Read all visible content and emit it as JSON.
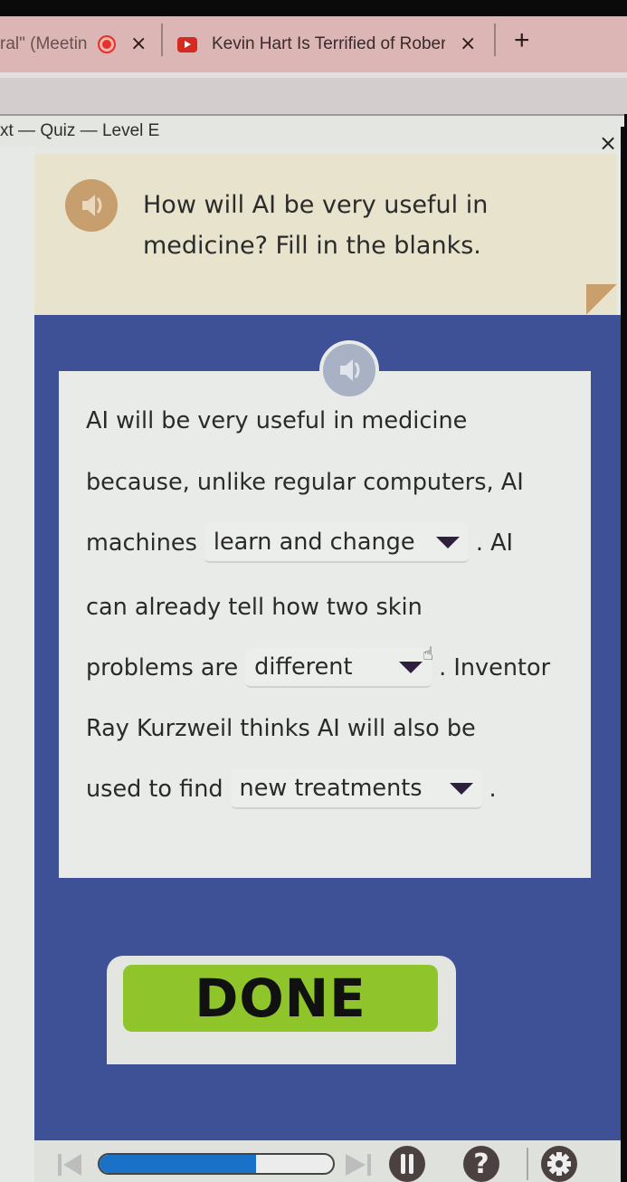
{
  "browser": {
    "tabs": [
      {
        "title": "ral\" (Meetin",
        "icon": "recording-icon",
        "close_label": "×"
      },
      {
        "title": "Kevin Hart Is Terrified of Robert",
        "icon": "youtube-icon",
        "close_label": "×"
      }
    ],
    "new_tab_label": "+"
  },
  "app": {
    "title": "xt — Quiz — Level E",
    "close_label": "×"
  },
  "question": {
    "text": "How will AI be very useful in medicine? Fill in the blanks.",
    "speaker_icon": "speaker-icon"
  },
  "passage": {
    "speaker_icon": "speaker-icon",
    "lines": [
      {
        "before": "AI will be very useful in medicine"
      },
      {
        "before": "because, unlike regular computers, AI"
      },
      {
        "before": "machines",
        "dropdown_value": "learn and change",
        "after": ". AI"
      },
      {
        "before": "can already tell how two skin"
      },
      {
        "before": "problems are",
        "dropdown_value": "different",
        "after": ". Inventor"
      },
      {
        "before": "Ray Kurzweil thinks AI will also be"
      },
      {
        "before": "used to find",
        "dropdown_value": "new treatments",
        "after": "."
      }
    ]
  },
  "done_button": {
    "label": "DONE",
    "color": "#8fc42a"
  },
  "controls": {
    "progress_percent": 67,
    "progress_color": "#1a72c8",
    "help_label": "?",
    "icons": [
      "previous-icon",
      "next-icon",
      "pause-icon",
      "help-icon",
      "settings-icon"
    ]
  },
  "colors": {
    "panel_blue": "#3e5196",
    "question_bg": "#e8e3cd",
    "speaker_tan": "#c79e6e"
  }
}
